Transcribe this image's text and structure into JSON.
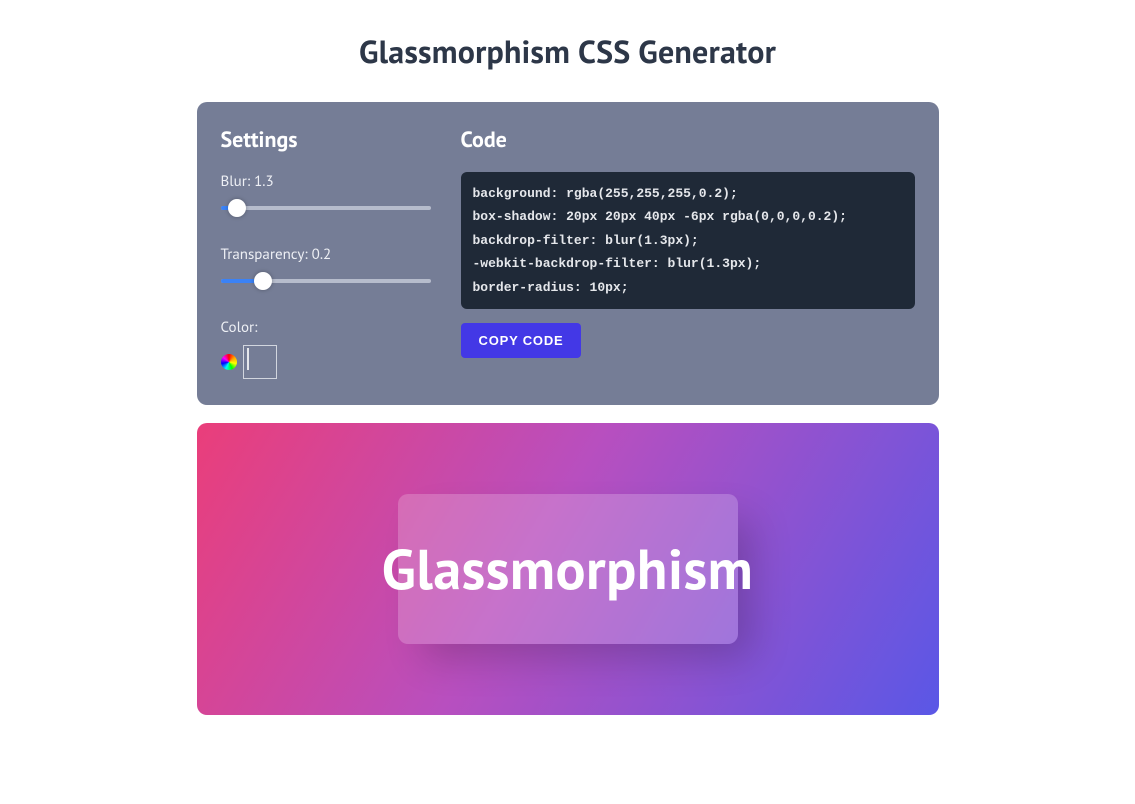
{
  "page": {
    "title": "Glassmorphism CSS Generator"
  },
  "settings": {
    "heading": "Settings",
    "blur": {
      "label": "Blur: 1.3",
      "value": 1.3,
      "min": 0,
      "max": 20,
      "pct": 8
    },
    "transp": {
      "label": "Transparency: 0.2",
      "value": 0.2,
      "min": 0,
      "max": 1,
      "pct": 20
    },
    "color": {
      "label": "Color:",
      "value": "#ffffff"
    }
  },
  "code": {
    "heading": "Code",
    "lines": [
      "background: rgba(255,255,255,0.2);",
      "box-shadow: 20px 20px 40px -6px rgba(0,0,0,0.2);",
      "backdrop-filter: blur(1.3px);",
      "-webkit-backdrop-filter: blur(1.3px);",
      "border-radius: 10px;"
    ],
    "copy_label": "COPY CODE"
  },
  "preview": {
    "card_text": "Glassmorphism"
  }
}
